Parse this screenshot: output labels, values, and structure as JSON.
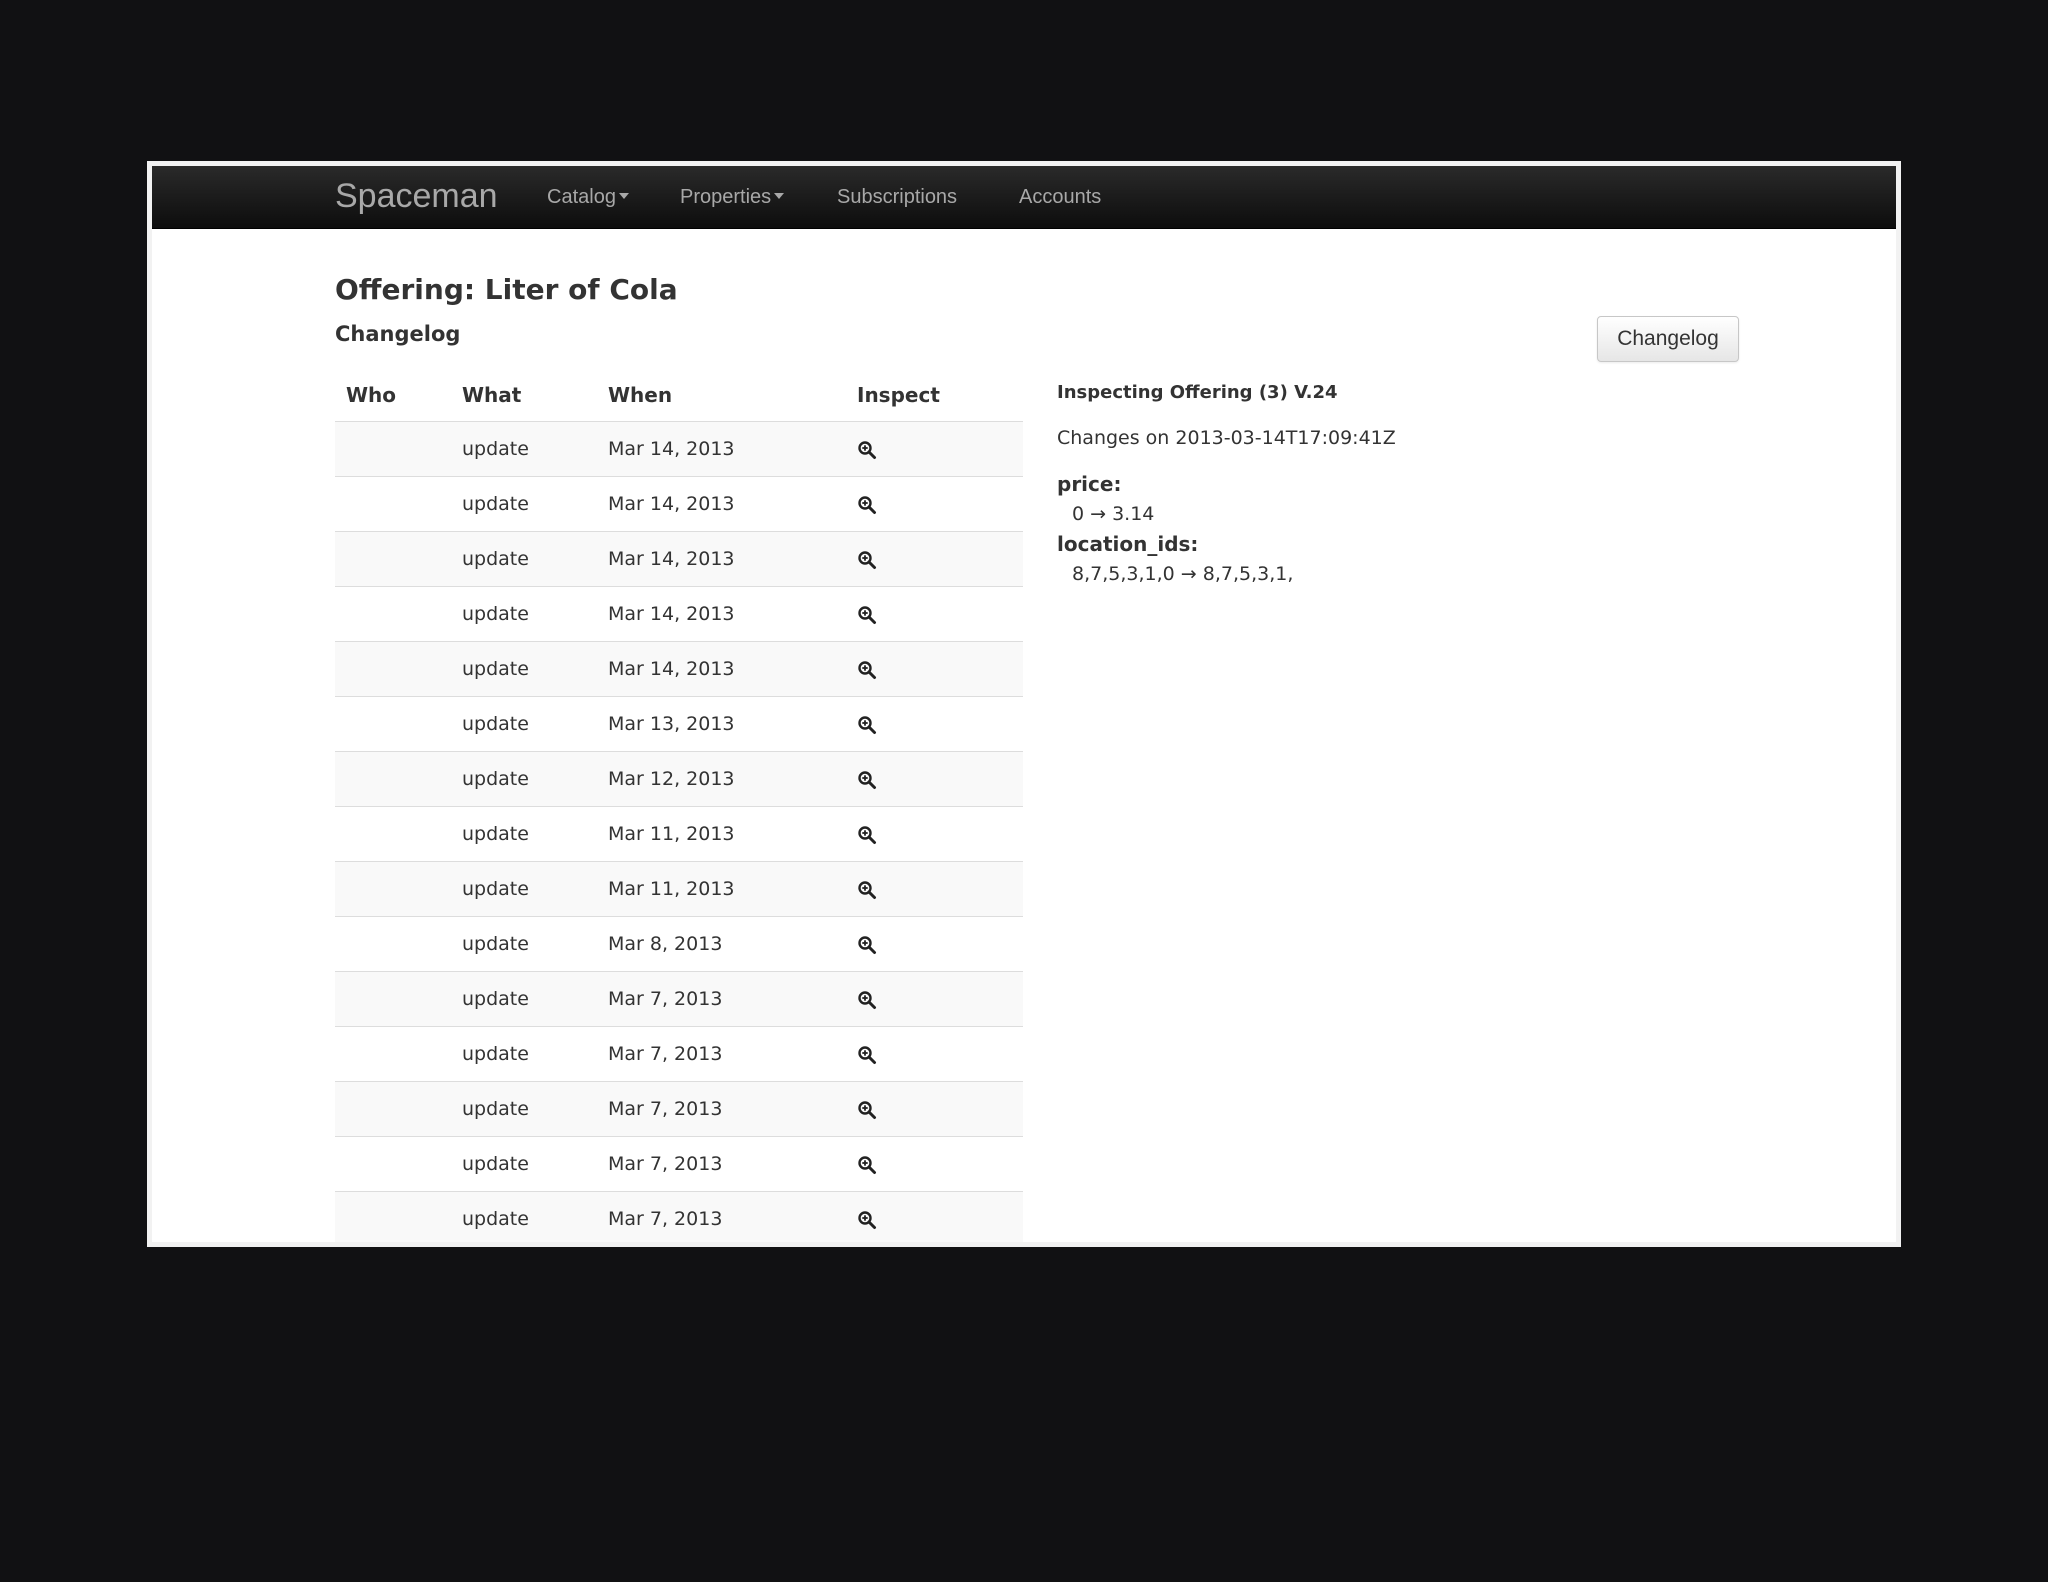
{
  "navbar": {
    "brand": "Spaceman",
    "items": [
      {
        "label": "Catalog",
        "dropdown": true
      },
      {
        "label": "Properties",
        "dropdown": true
      },
      {
        "label": "Subscriptions",
        "dropdown": false
      },
      {
        "label": "Accounts",
        "dropdown": false
      }
    ]
  },
  "page": {
    "title": "Offering: Liter of Cola",
    "section_title": "Changelog",
    "changelog_button": "Changelog"
  },
  "table": {
    "headers": [
      "Who",
      "What",
      "When",
      "Inspect"
    ],
    "rows": [
      {
        "who": "",
        "what": "update",
        "when": "Mar 14, 2013"
      },
      {
        "who": "",
        "what": "update",
        "when": "Mar 14, 2013"
      },
      {
        "who": "",
        "what": "update",
        "when": "Mar 14, 2013"
      },
      {
        "who": "",
        "what": "update",
        "when": "Mar 14, 2013"
      },
      {
        "who": "",
        "what": "update",
        "when": "Mar 14, 2013"
      },
      {
        "who": "",
        "what": "update",
        "when": "Mar 13, 2013"
      },
      {
        "who": "",
        "what": "update",
        "when": "Mar 12, 2013"
      },
      {
        "who": "",
        "what": "update",
        "when": "Mar 11, 2013"
      },
      {
        "who": "",
        "what": "update",
        "when": "Mar 11, 2013"
      },
      {
        "who": "",
        "what": "update",
        "when": "Mar 8, 2013"
      },
      {
        "who": "",
        "what": "update",
        "when": "Mar 7, 2013"
      },
      {
        "who": "",
        "what": "update",
        "when": "Mar 7, 2013"
      },
      {
        "who": "",
        "what": "update",
        "when": "Mar 7, 2013"
      },
      {
        "who": "",
        "what": "update",
        "when": "Mar 7, 2013"
      },
      {
        "who": "",
        "what": "update",
        "when": "Mar 7, 2013"
      }
    ],
    "inspect_icon": "zoom-in-icon"
  },
  "inspect": {
    "title": "Inspecting Offering (3) V.24",
    "changes_on": "Changes on 2013-03-14T17:09:41Z",
    "fields": [
      {
        "name": "price:",
        "change": "0 → 3.14"
      },
      {
        "name": "location_ids:",
        "change": "8,7,5,3,1,0 → 8,7,5,3,1,"
      }
    ]
  }
}
